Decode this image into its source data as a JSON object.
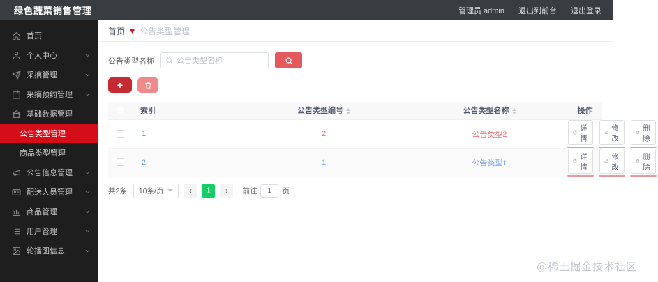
{
  "header": {
    "title": "绿色蔬菜销售管理",
    "user": "管理员 admin",
    "exit_front": "退出到前台",
    "logout": "退出登录"
  },
  "sidebar": {
    "items": [
      {
        "label": "首页",
        "icon": "home-icon"
      },
      {
        "label": "个人中心",
        "icon": "user-icon"
      },
      {
        "label": "采摘管理",
        "icon": "send-icon"
      },
      {
        "label": "采摘预约管理",
        "icon": "calendar-icon"
      },
      {
        "label": "基础数据管理",
        "icon": "bank-icon"
      },
      {
        "label": "公告类型管理",
        "active": true
      },
      {
        "label": "商品类型管理"
      },
      {
        "label": "公告信息管理",
        "icon": "megaphone-icon"
      },
      {
        "label": "配送人员管理",
        "icon": "id-card-icon"
      },
      {
        "label": "商品管理",
        "icon": "chart-icon"
      },
      {
        "label": "用户管理",
        "icon": "list-icon"
      },
      {
        "label": "轮播图信息",
        "icon": "image-icon"
      }
    ]
  },
  "breadcrumb": {
    "home": "首页",
    "separator": "♥",
    "current": "公告类型管理"
  },
  "search": {
    "label": "公告类型名称",
    "placeholder": "公告类型名称"
  },
  "toolbar": {
    "add_label": "+"
  },
  "table": {
    "columns": {
      "index": "索引",
      "code": "公告类型编号",
      "name": "公告类型名称",
      "ops": "操作"
    },
    "rows": [
      {
        "index": "1",
        "code": "2",
        "name": "公告类型2",
        "highlighted": true
      },
      {
        "index": "2",
        "code": "1",
        "name": "公告类型1",
        "highlighted": false
      }
    ],
    "actions": [
      "详情",
      "修改",
      "删除"
    ]
  },
  "pagination": {
    "total": "共2条",
    "page_size": "10条/页",
    "prev": "‹",
    "page": "1",
    "next": "›",
    "goto_label": "前往",
    "goto_value": "1",
    "goto_unit": "页"
  },
  "watermark": "@稀土掘金技术社区",
  "colors": {
    "accent_red": "#d40d19",
    "search_button_red": "#e4595c",
    "add_button_red": "#c42a32",
    "batch_delete_red": "#ef8a8a",
    "row_highlight_red": "#f26d6d",
    "link_blue": "#74a4ee",
    "pagination_green": "#13ce66",
    "header_bg": "#373d41",
    "sidebar_bg": "#1e1e1e"
  }
}
